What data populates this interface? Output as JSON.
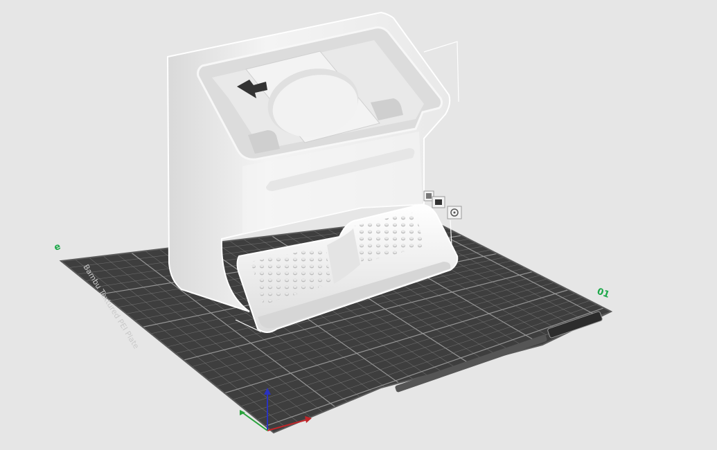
{
  "plate": {
    "label": "Bambu Textured PEI Plate",
    "number_left": "e",
    "number_right": "01",
    "grid_color": "#8a8a8a",
    "plate_color": "#3e3e3e",
    "accent_green": "#1ea84a"
  },
  "model": {
    "color": "#f2f2f2",
    "shadow_color": "#c9c9c9",
    "outline_color": "#ffffff"
  },
  "axes": {
    "x_color": "#c0262a",
    "y_color": "#2aa33d",
    "z_color": "#2a33c0"
  },
  "icons": {
    "plate_tool_1": "plate-layers-icon",
    "plate_tool_2": "plate-view-icon",
    "plate_tool_3": "plate-settings-icon"
  }
}
